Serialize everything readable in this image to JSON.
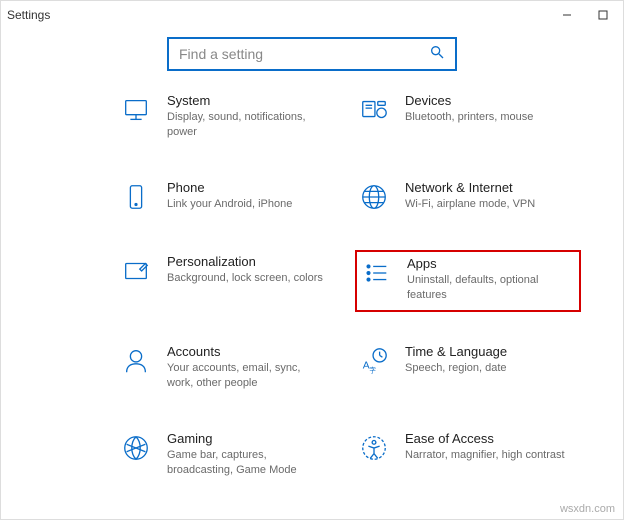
{
  "window": {
    "title": "Settings",
    "search_placeholder": "Find a setting"
  },
  "tiles": {
    "system": {
      "title": "System",
      "subtitle": "Display, sound, notifications, power"
    },
    "devices": {
      "title": "Devices",
      "subtitle": "Bluetooth, printers, mouse"
    },
    "phone": {
      "title": "Phone",
      "subtitle": "Link your Android, iPhone"
    },
    "network": {
      "title": "Network & Internet",
      "subtitle": "Wi-Fi, airplane mode, VPN"
    },
    "personalization": {
      "title": "Personalization",
      "subtitle": "Background, lock screen, colors"
    },
    "apps": {
      "title": "Apps",
      "subtitle": "Uninstall, defaults, optional features"
    },
    "accounts": {
      "title": "Accounts",
      "subtitle": "Your accounts, email, sync, work, other people"
    },
    "time": {
      "title": "Time & Language",
      "subtitle": "Speech, region, date"
    },
    "gaming": {
      "title": "Gaming",
      "subtitle": "Game bar, captures, broadcasting, Game Mode"
    },
    "ease": {
      "title": "Ease of Access",
      "subtitle": "Narrator, magnifier, high contrast"
    }
  },
  "watermark": "wsxdn.com"
}
